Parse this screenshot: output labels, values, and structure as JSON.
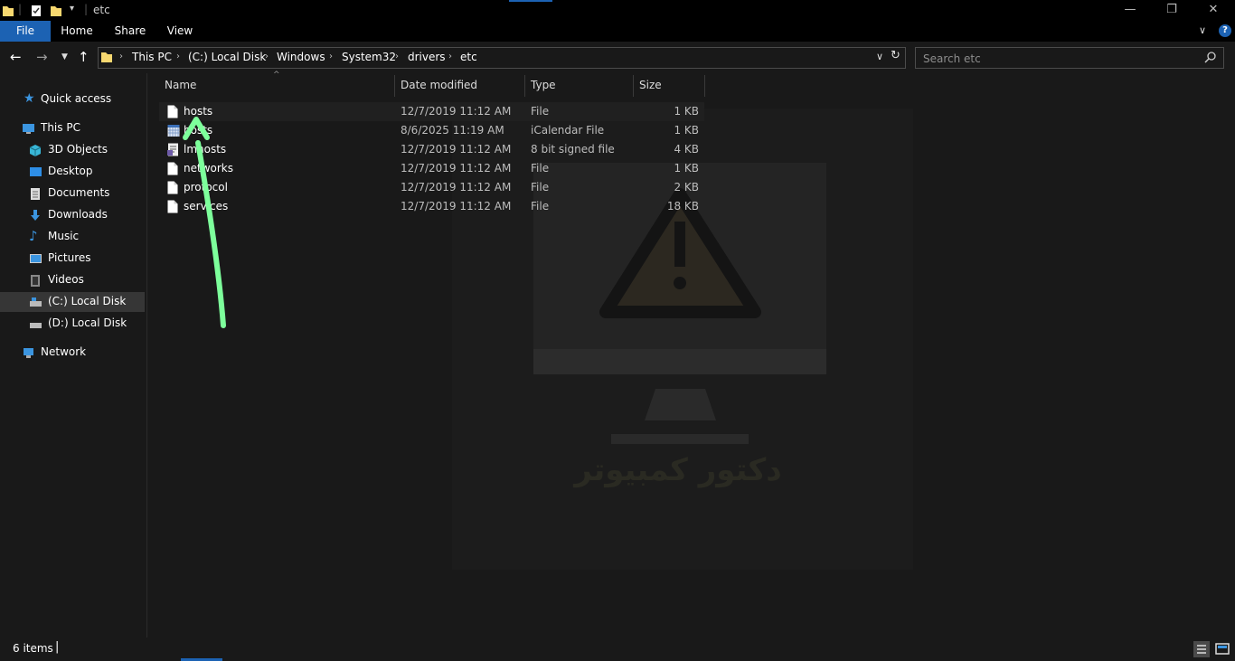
{
  "window": {
    "title": "etc"
  },
  "ribbon": {
    "tabs": [
      "File",
      "Home",
      "Share",
      "View"
    ]
  },
  "address": {
    "crumbs": [
      "This PC",
      "(C:) Local Disk",
      "Windows",
      "System32",
      "drivers",
      "etc"
    ]
  },
  "search": {
    "placeholder": "Search etc"
  },
  "nav": {
    "quick_access": "Quick access",
    "this_pc": "This PC",
    "items": [
      "3D Objects",
      "Desktop",
      "Documents",
      "Downloads",
      "Music",
      "Pictures",
      "Videos",
      "(C:) Local Disk",
      "(D:) Local Disk"
    ],
    "network": "Network"
  },
  "columns": {
    "name": "Name",
    "date": "Date modified",
    "type": "Type",
    "size": "Size"
  },
  "files": [
    {
      "name": "hosts",
      "date": "12/7/2019 11:12 AM",
      "type": "File",
      "size": "1 KB",
      "icon": "file-icon"
    },
    {
      "name": "hosts",
      "date": "8/6/2025 11:19 AM",
      "type": "iCalendar File",
      "size": "1 KB",
      "icon": "calendar-file-icon"
    },
    {
      "name": "lmhosts",
      "date": "12/7/2019 11:12 AM",
      "type": "8 bit signed file",
      "size": "4 KB",
      "icon": "signed-file-icon"
    },
    {
      "name": "networks",
      "date": "12/7/2019 11:12 AM",
      "type": "File",
      "size": "1 KB",
      "icon": "file-icon"
    },
    {
      "name": "protocol",
      "date": "12/7/2019 11:12 AM",
      "type": "File",
      "size": "2 KB",
      "icon": "file-icon"
    },
    {
      "name": "services",
      "date": "12/7/2019 11:12 AM",
      "type": "File",
      "size": "18 KB",
      "icon": "file-icon"
    }
  ],
  "status": {
    "items": "6 items"
  },
  "watermark": {
    "text": "دكتور كمبيوتر"
  },
  "colors": {
    "accent": "#1c62b3",
    "annotation": "#7dff9b",
    "folder": "#f7d870"
  }
}
